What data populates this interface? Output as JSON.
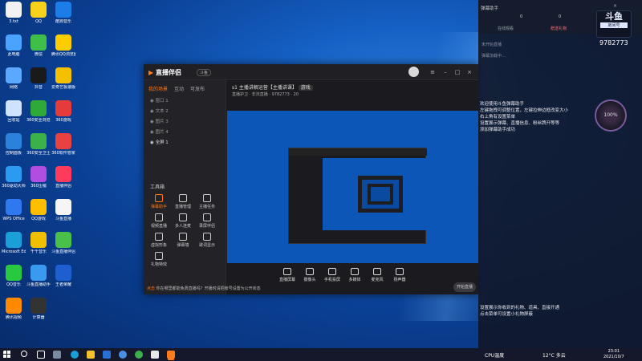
{
  "desktop": {
    "icons": [
      {
        "label": "3.txt",
        "color": "#f2f2f2"
      },
      {
        "label": "QQ",
        "color": "#f7d11a"
      },
      {
        "label": "酷狗音乐",
        "color": "#1d7de8"
      },
      {
        "label": "此电脑",
        "color": "#4aa3ff"
      },
      {
        "label": "微信",
        "color": "#3fbf4a"
      },
      {
        "label": "腾讯QQ浏览器",
        "color": "#ffcc00"
      },
      {
        "label": "网络",
        "color": "#5aa8ff"
      },
      {
        "label": "抖音",
        "color": "#1a1a1a"
      },
      {
        "label": "爱奇艺极速版",
        "color": "#f4c000"
      },
      {
        "label": "回收站",
        "color": "#cfe3ff"
      },
      {
        "label": "360安全浏览器",
        "color": "#2faa3a"
      },
      {
        "label": "360游戏",
        "color": "#e63b3b"
      },
      {
        "label": "控制面板",
        "color": "#2a82da"
      },
      {
        "label": "360安全卫士",
        "color": "#3cb04a"
      },
      {
        "label": "360软件管家",
        "color": "#e84141"
      },
      {
        "label": "360驱动大师",
        "color": "#2b9bf2"
      },
      {
        "label": "360压缩",
        "color": "#b14de0"
      },
      {
        "label": "直播伴侣",
        "color": "#ff3b5c"
      },
      {
        "label": "WPS Office",
        "color": "#2f78f0"
      },
      {
        "label": "QQ游戏",
        "color": "#ffbf00"
      },
      {
        "label": "斗鱼直播",
        "color": "#f5f5f5"
      },
      {
        "label": "Microsoft Edge",
        "color": "#1a9fd8"
      },
      {
        "label": "千千音乐",
        "color": "#f0c000"
      },
      {
        "label": "斗鱼直播伴侣",
        "color": "#48c04a"
      },
      {
        "label": "QQ音乐",
        "color": "#28c840"
      },
      {
        "label": "斗鱼直播助手",
        "color": "#3a9af0"
      },
      {
        "label": "王者荣耀",
        "color": "#1d5fd0"
      },
      {
        "label": "腾讯视频",
        "color": "#ff8a00"
      },
      {
        "label": "计算器",
        "color": "#333333"
      }
    ]
  },
  "app": {
    "brand": "直播伴侣",
    "version": "斗鱼",
    "sidebar_tabs": [
      "我的场景",
      "互动",
      "可发布"
    ],
    "scenes": [
      "窗口 1",
      "文本 2",
      "图片 3",
      "图片 4",
      "全屏 1"
    ],
    "tools_title": "工具箱",
    "tools": [
      "弹幕助手",
      "直播管理",
      "主播任务",
      "视频直播",
      "多人连麦",
      "录屏伴侣",
      "虚拟形象",
      "弹幕墙",
      "歌词显示",
      "礼物特效"
    ],
    "stream_title": "s1 主播讲解运营【主播讲课】",
    "stream_tag": "游戏",
    "stream_meta": [
      "直播护卫",
      "非法直播",
      "9782773",
      "20"
    ],
    "bottom_buttons": [
      "直播屏幕",
      "摄像头",
      "手机投屏",
      "多媒体",
      "麦克风",
      "扬声器"
    ],
    "start_label": "开始直播",
    "tip_prefix": "点击",
    "tip_text": "你在哪里都能免费直播吗？开播时请把帐号设置为公开状态"
  },
  "panel": {
    "title": "弹幕助手",
    "counts": [
      "0",
      "0"
    ],
    "tabs": [
      "在线观看",
      "赠送礼物"
    ],
    "status_lines": [
      "未开始直播",
      "弹幕加载中…"
    ],
    "brand_text": "斗鱼",
    "room_label": "房间号",
    "room_id": "9782773",
    "gauge": "100%",
    "help": [
      "欢迎使用斗鱼弹幕助手",
      "左键拖拽可调整位置，左键拉伸边框改变大小",
      "右上角有设置菜单",
      "设置展示弹幕、直播信息、粉丝牌开等等",
      "添加弹幕助手成功"
    ],
    "gift_help": [
      "设置展示你收到的礼物、道具、直接开通",
      "点击菜单可设置小礼物屏蔽"
    ]
  },
  "taskbar": {
    "cpu": "CPU温度",
    "weather": "12°C 多云",
    "time": "23:01",
    "date": "2021/10/7"
  }
}
